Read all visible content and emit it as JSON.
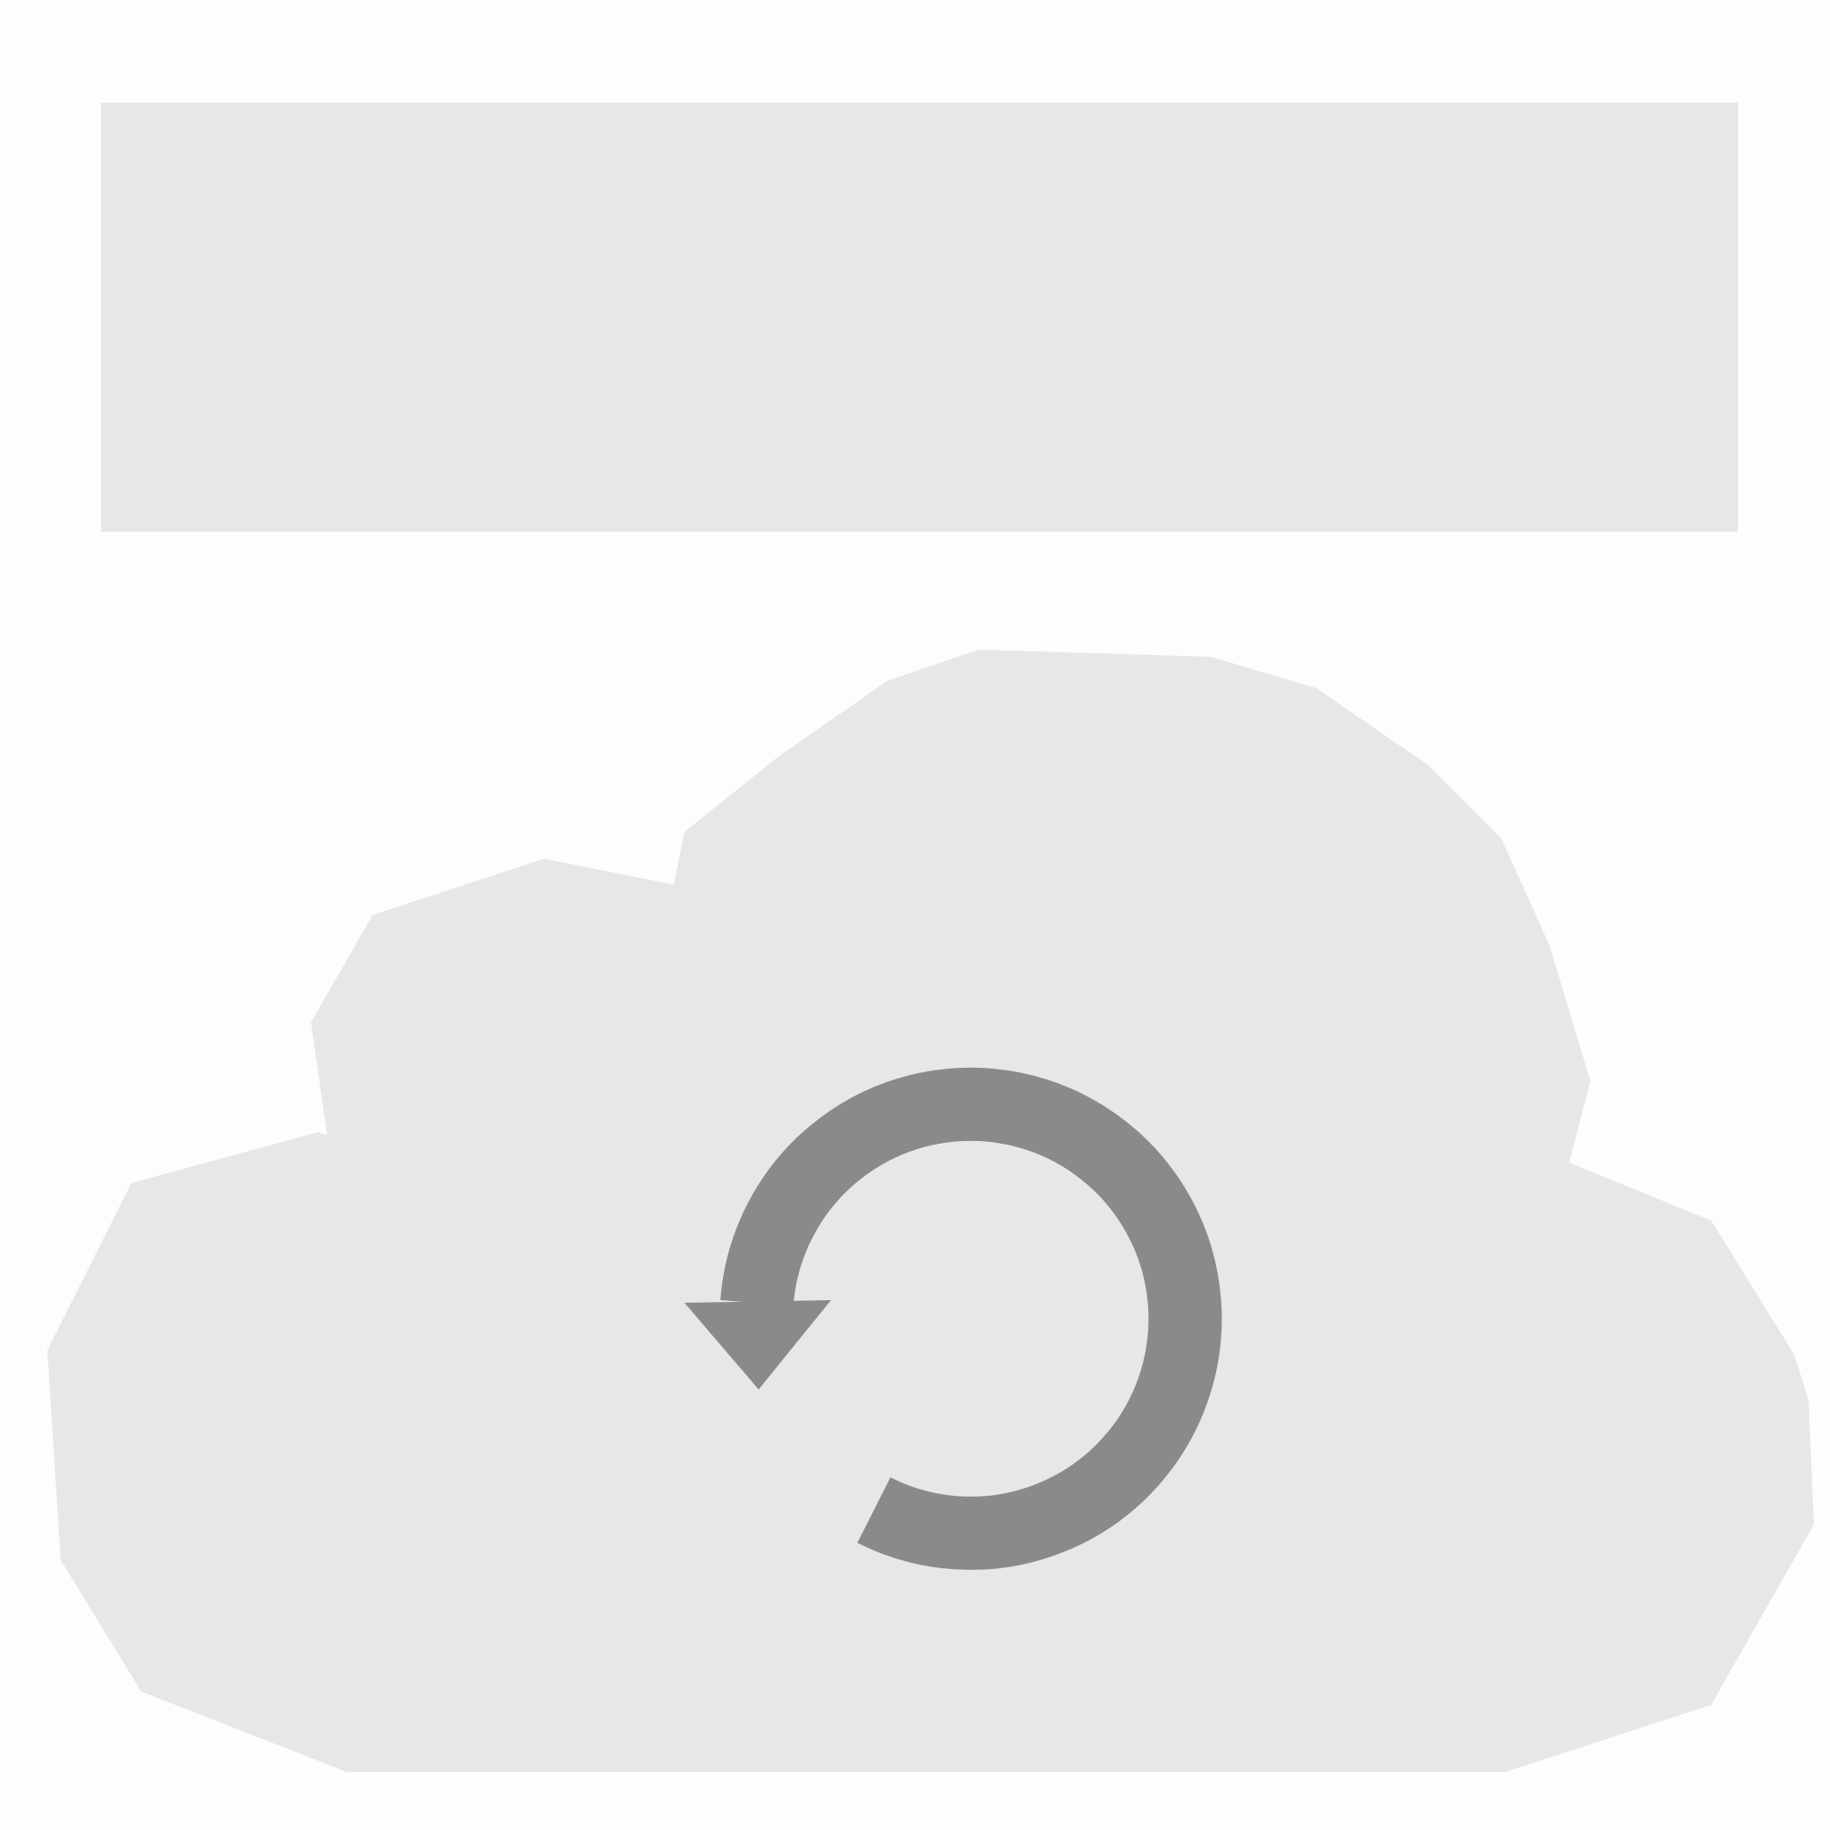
{
  "colors": {
    "background": "#fdfdfd",
    "banner": "#e7e7e7",
    "cloud": "#e7e7e7",
    "icon": "#8a8a8a"
  },
  "icons": {
    "cloud": "cloud-icon",
    "sync": "sync-refresh-icon"
  }
}
